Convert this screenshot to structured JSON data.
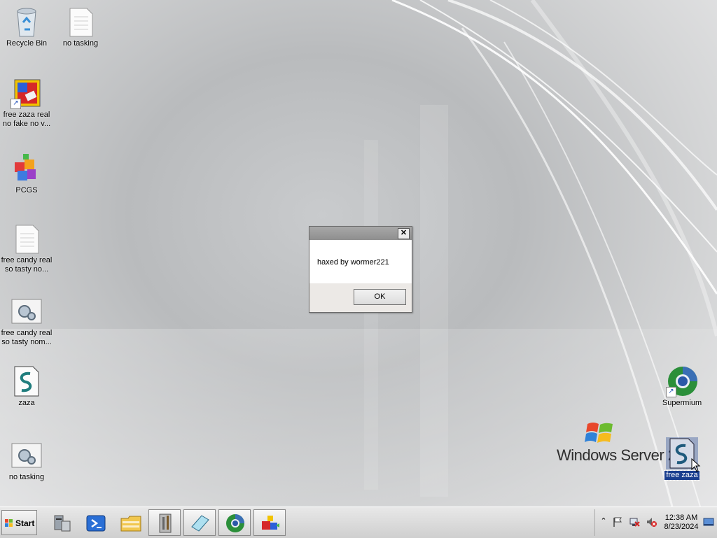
{
  "desktop": {
    "icons": [
      {
        "label": "Recycle Bin",
        "icon": "recycle-bin-icon"
      },
      {
        "label": "no tasking",
        "icon": "text-file-icon"
      },
      {
        "label": "free zaza real\nno fake no v...",
        "icon": "installer-shortcut-icon"
      },
      {
        "label": "PCGS",
        "icon": "blocks-app-icon"
      },
      {
        "label": "free candy real\nso tasty no...",
        "icon": "text-file-icon"
      },
      {
        "label": "free candy real\nso tasty nom...",
        "icon": "settings-file-icon"
      },
      {
        "label": "zaza",
        "icon": "script-file-icon"
      },
      {
        "label": "no tasking",
        "icon": "settings-file-icon"
      },
      {
        "label": "Supermium",
        "icon": "browser-shortcut-icon"
      },
      {
        "label": "free zaza",
        "icon": "script-file-icon"
      }
    ],
    "wallpaper_brand": "Windows Server 20"
  },
  "dialog": {
    "title": "",
    "message": "haxed by wormer221",
    "ok_label": "OK",
    "close_symbol": "✕"
  },
  "taskbar": {
    "start_label": "Start",
    "buttons": [
      {
        "icon": "server-manager-icon"
      },
      {
        "icon": "powershell-icon"
      },
      {
        "icon": "file-explorer-icon"
      },
      {
        "icon": "admin-tools-icon"
      },
      {
        "icon": "notepad-icon"
      },
      {
        "icon": "supermium-icon"
      },
      {
        "icon": "blocks-app-icon"
      }
    ],
    "tray": {
      "icons": [
        "show-hidden-icon",
        "action-center-flag-icon",
        "network-error-icon",
        "volume-muted-icon",
        "show-desktop-icon"
      ],
      "time": "12:38 AM",
      "date": "8/23/2024"
    }
  },
  "colors": {
    "selection": "#1b3f8f",
    "dialog_bg": "#ece9e6"
  }
}
